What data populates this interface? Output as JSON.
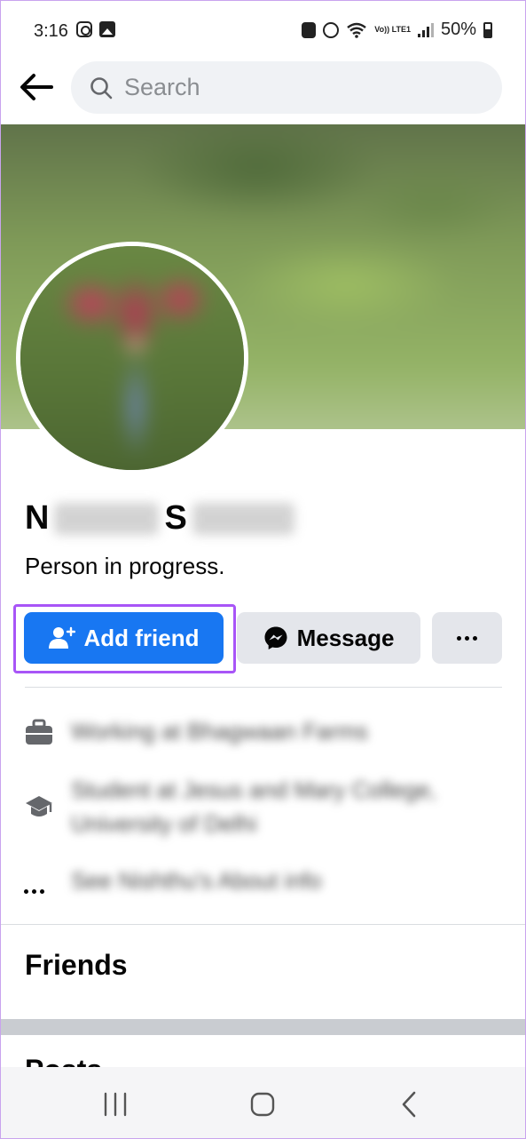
{
  "status_bar": {
    "time": "3:16",
    "battery": "50%",
    "volte": "Vo)) LTE1"
  },
  "header": {
    "search_placeholder": "Search"
  },
  "profile": {
    "name_first_initial": "N",
    "name_last_initial": "S",
    "bio": "Person in progress."
  },
  "actions": {
    "add_friend_label": "Add friend",
    "message_label": "Message"
  },
  "intro": {
    "work_text": "Working at Bhagwaan Farms",
    "education_text": "Student at Jesus and Mary College, University of Delhi",
    "about_text": "See Nishthu's About info"
  },
  "sections": {
    "friends_title": "Friends",
    "posts_title": "Posts"
  },
  "colors": {
    "primary_blue": "#1877f2",
    "highlight_purple": "#a855f7",
    "secondary_gray": "#e4e6eb"
  }
}
